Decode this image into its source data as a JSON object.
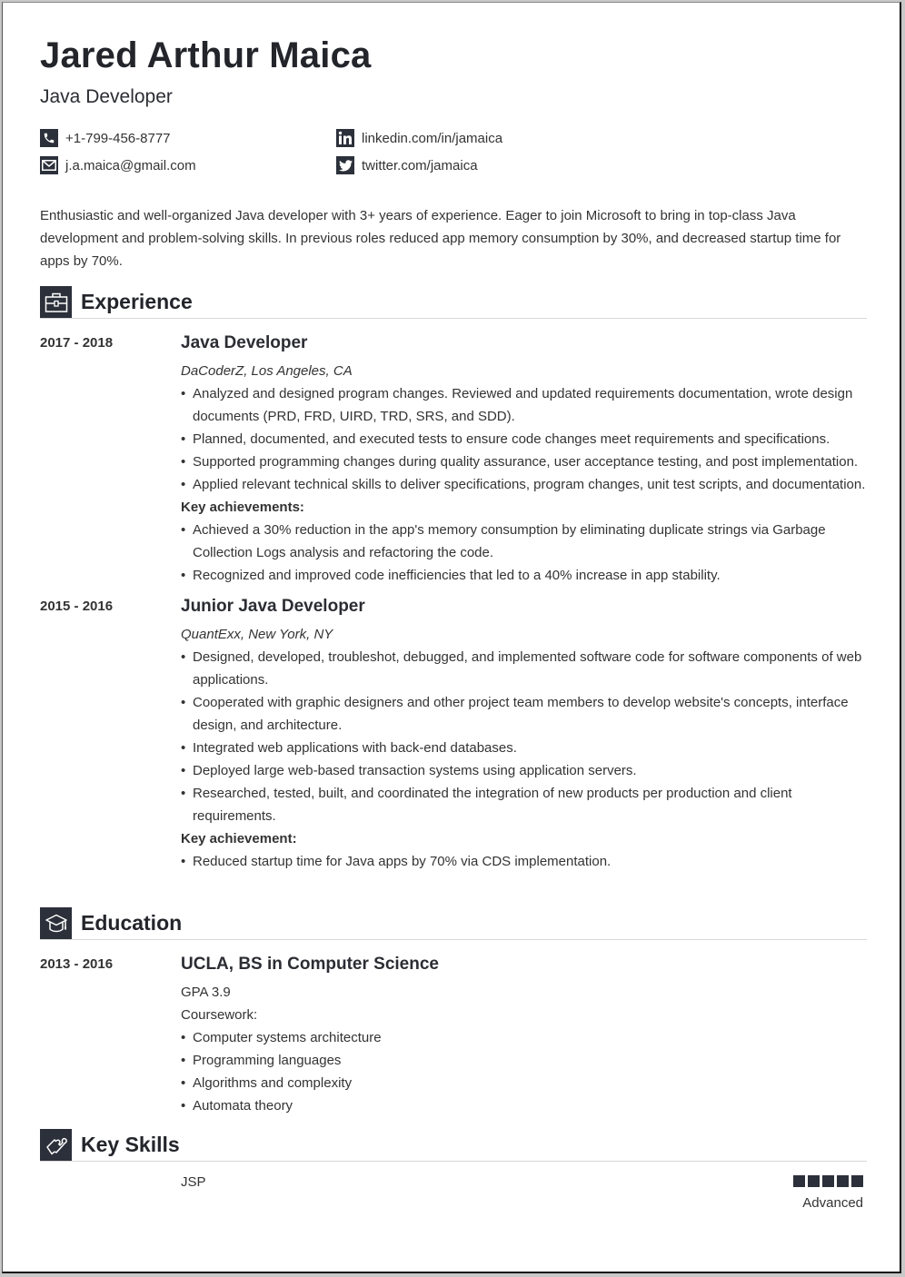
{
  "header": {
    "name": "Jared Arthur Maica",
    "title": "Java Developer"
  },
  "contacts": {
    "phone": {
      "icon": "phone-icon",
      "text": "+1-799-456-8777"
    },
    "email": {
      "icon": "mail-icon",
      "text": "j.a.maica@gmail.com"
    },
    "linkedin": {
      "icon": "linkedin-icon",
      "text": "linkedin.com/in/jamaica"
    },
    "twitter": {
      "icon": "twitter-icon",
      "text": "twitter.com/jamaica"
    }
  },
  "summary": "Enthusiastic and well-organized Java developer with 3+ years of experience. Eager to join Microsoft to bring in top-class Java development and problem-solving skills. In previous roles reduced app memory consumption by 30%, and decreased startup time for apps by 70%.",
  "experience": {
    "title": "Experience",
    "icon": "briefcase-icon",
    "jobs": [
      {
        "dates": "2017 - 2018",
        "role": "Java Developer",
        "company": "DaCoderZ, Los Angeles, CA",
        "bullets": [
          "Analyzed and designed program changes. Reviewed and updated requirements documentation, wrote design documents (PRD, FRD, UIRD, TRD, SRS, and SDD).",
          "Planned, documented, and executed tests to ensure code changes meet requirements and specifications.",
          "Supported programming changes during quality assurance, user acceptance testing, and post implementation.",
          "Applied relevant technical skills to deliver specifications, program changes, unit test scripts, and documentation."
        ],
        "achievements_label": "Key achievements:",
        "achievements": [
          "Achieved a 30% reduction in the app's memory consumption by eliminating duplicate strings via Garbage Collection Logs analysis and refactoring the code.",
          "Recognized and improved code inefficiencies that led to a 40% increase in app stability."
        ]
      },
      {
        "dates": "2015 - 2016",
        "role": "Junior Java Developer",
        "company": "QuantExx, New York, NY",
        "bullets": [
          "Designed, developed, troubleshot, debugged, and implemented software code for software components of web applications.",
          "Cooperated with graphic designers and other project team members to develop website's concepts, interface design, and architecture.",
          "Integrated web applications with back-end databases.",
          "Deployed large web-based transaction systems using application servers.",
          "Researched, tested, built, and coordinated the integration of new products per production and client requirements."
        ],
        "achievements_label": "Key achievement:",
        "achievements": [
          "Reduced startup time for Java apps by 70% via CDS implementation."
        ]
      }
    ]
  },
  "education": {
    "title": "Education",
    "icon": "graduation-cap-icon",
    "entries": [
      {
        "dates": "2013 - 2016",
        "degree": "UCLA, BS in Computer Science",
        "gpa": "GPA 3.9",
        "coursework_label": "Coursework:",
        "coursework": [
          "Computer systems architecture",
          "Programming languages",
          "Algorithms and complexity",
          "Automata theory"
        ]
      }
    ]
  },
  "skills": {
    "title": "Key Skills",
    "icon": "puzzle-icon",
    "items": [
      {
        "name": "JSP",
        "level": 5,
        "max_level": 5,
        "level_label": "Advanced"
      }
    ]
  }
}
